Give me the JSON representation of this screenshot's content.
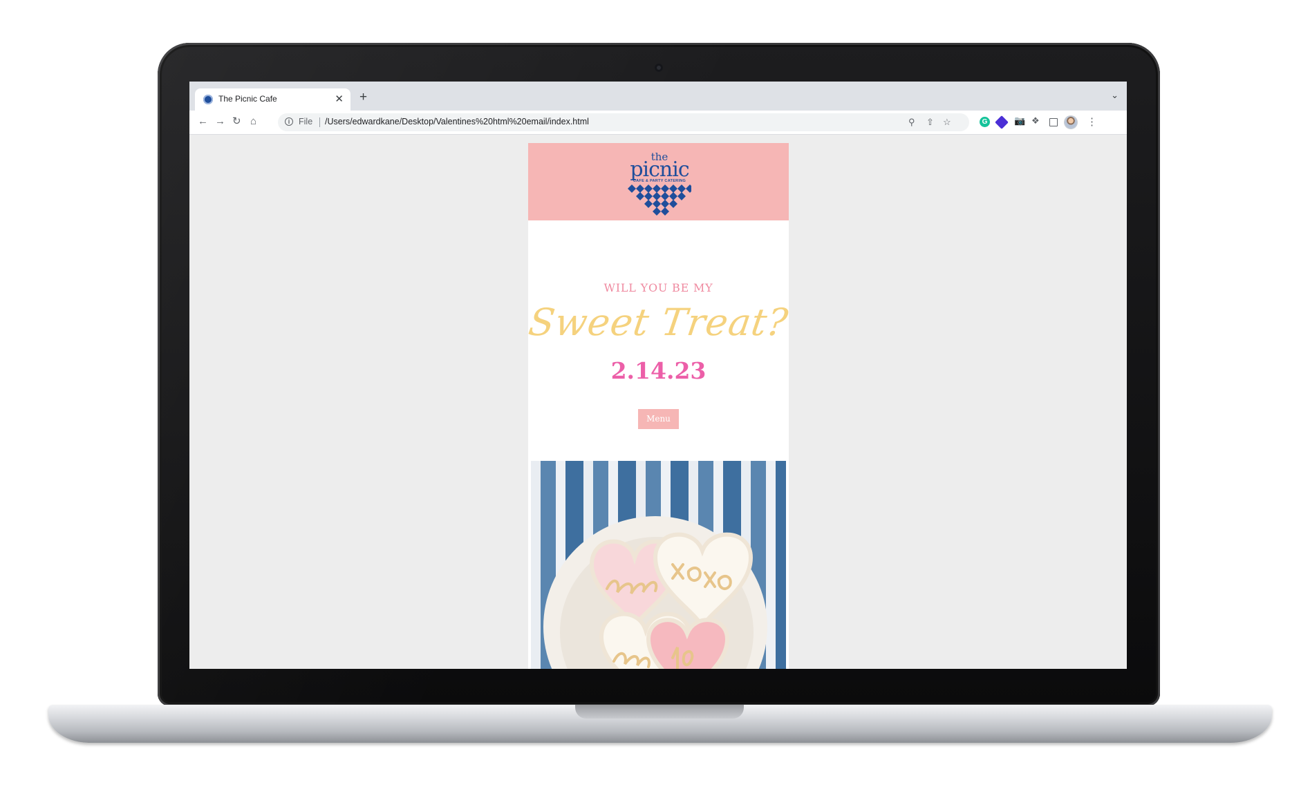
{
  "browser": {
    "tab_title": "The Picnic Cafe",
    "tab_close": "✕",
    "new_tab": "+",
    "tab_search": "⌄",
    "url_scheme": "File",
    "url": "/Users/edwardkane/Desktop/Valentines%20html%20email/index.html",
    "icons": [
      "back-arrow-icon",
      "forward-arrow-icon",
      "reload-icon",
      "home-icon",
      "info-icon",
      "zoom-icon",
      "share-icon",
      "bookmark-star-icon",
      "grammarly-icon",
      "extension-icon",
      "camera-icon",
      "puzzle-icon",
      "side-panel-icon",
      "avatar",
      "kebab-menu-icon"
    ]
  },
  "email": {
    "logo": {
      "the": "the",
      "name": "picnic",
      "tagline": "CAFE & PARTY CATERING"
    },
    "invite_line": "WILL YOU BE MY",
    "headline": "Sweet Treat?",
    "date": "2.14.23",
    "menu_button": "Menu"
  },
  "colors": {
    "header_pink": "#f6b6b5",
    "logo_blue": "#1f4e9b",
    "invite_pink": "#ef8aa0",
    "headline_yellow": "#f5d27e",
    "date_pink": "#ec5fa8",
    "page_bg": "#ededed"
  }
}
